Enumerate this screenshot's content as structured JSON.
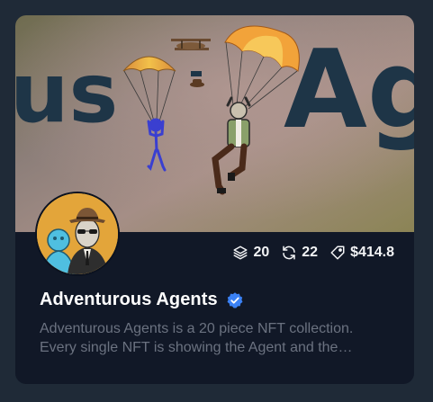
{
  "collection": {
    "name": "Adventurous Agents",
    "verified": true,
    "banner_text_left": "us",
    "banner_text_right": "Ag",
    "description_lines": [
      "Adventurous Agents is a 20 piece NFT collection.",
      "Every single NFT is showing the Agent and the…"
    ]
  },
  "stats": {
    "items": "20",
    "owners": "22",
    "floor": "$414.8"
  },
  "icons": {
    "items": "layers-icon",
    "owners": "refresh-icon",
    "floor": "tag-icon",
    "verified": "verified-badge-icon"
  },
  "colors": {
    "card_bg": "#111827",
    "page_bg": "#1f2a37",
    "verified_blue": "#3b82f6",
    "description_gray": "#6b7280"
  }
}
